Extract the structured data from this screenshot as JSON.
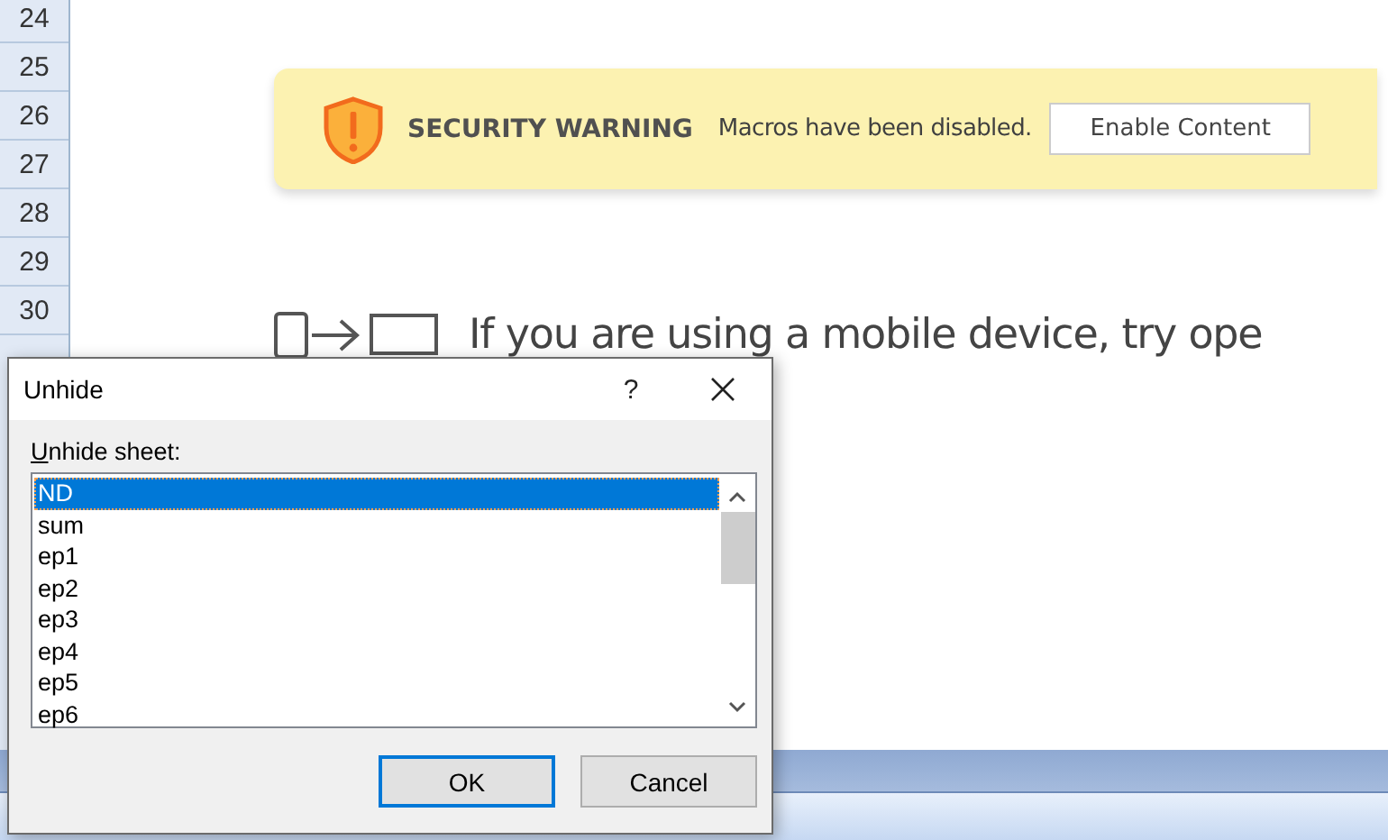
{
  "spreadsheet": {
    "row_headers": [
      "24",
      "25",
      "26",
      "27",
      "28",
      "29",
      "30"
    ]
  },
  "security_banner": {
    "title": "SECURITY WARNING",
    "message": "Macros have been disabled.",
    "button": "Enable Content"
  },
  "mobile_hint": "If you are using a mobile device, try ope",
  "dialog": {
    "title": "Unhide",
    "help_button": "?",
    "label": "Unhide sheet:",
    "sheets": [
      {
        "name": "ND",
        "selected": true
      },
      {
        "name": "sum",
        "selected": false
      },
      {
        "name": "ep1",
        "selected": false
      },
      {
        "name": "ep2",
        "selected": false
      },
      {
        "name": "ep3",
        "selected": false
      },
      {
        "name": "ep4",
        "selected": false
      },
      {
        "name": "ep5",
        "selected": false
      },
      {
        "name": "ep6",
        "selected": false
      }
    ],
    "buttons": [
      {
        "label": "OK",
        "default": true
      },
      {
        "label": "Cancel",
        "default": false
      }
    ]
  }
}
